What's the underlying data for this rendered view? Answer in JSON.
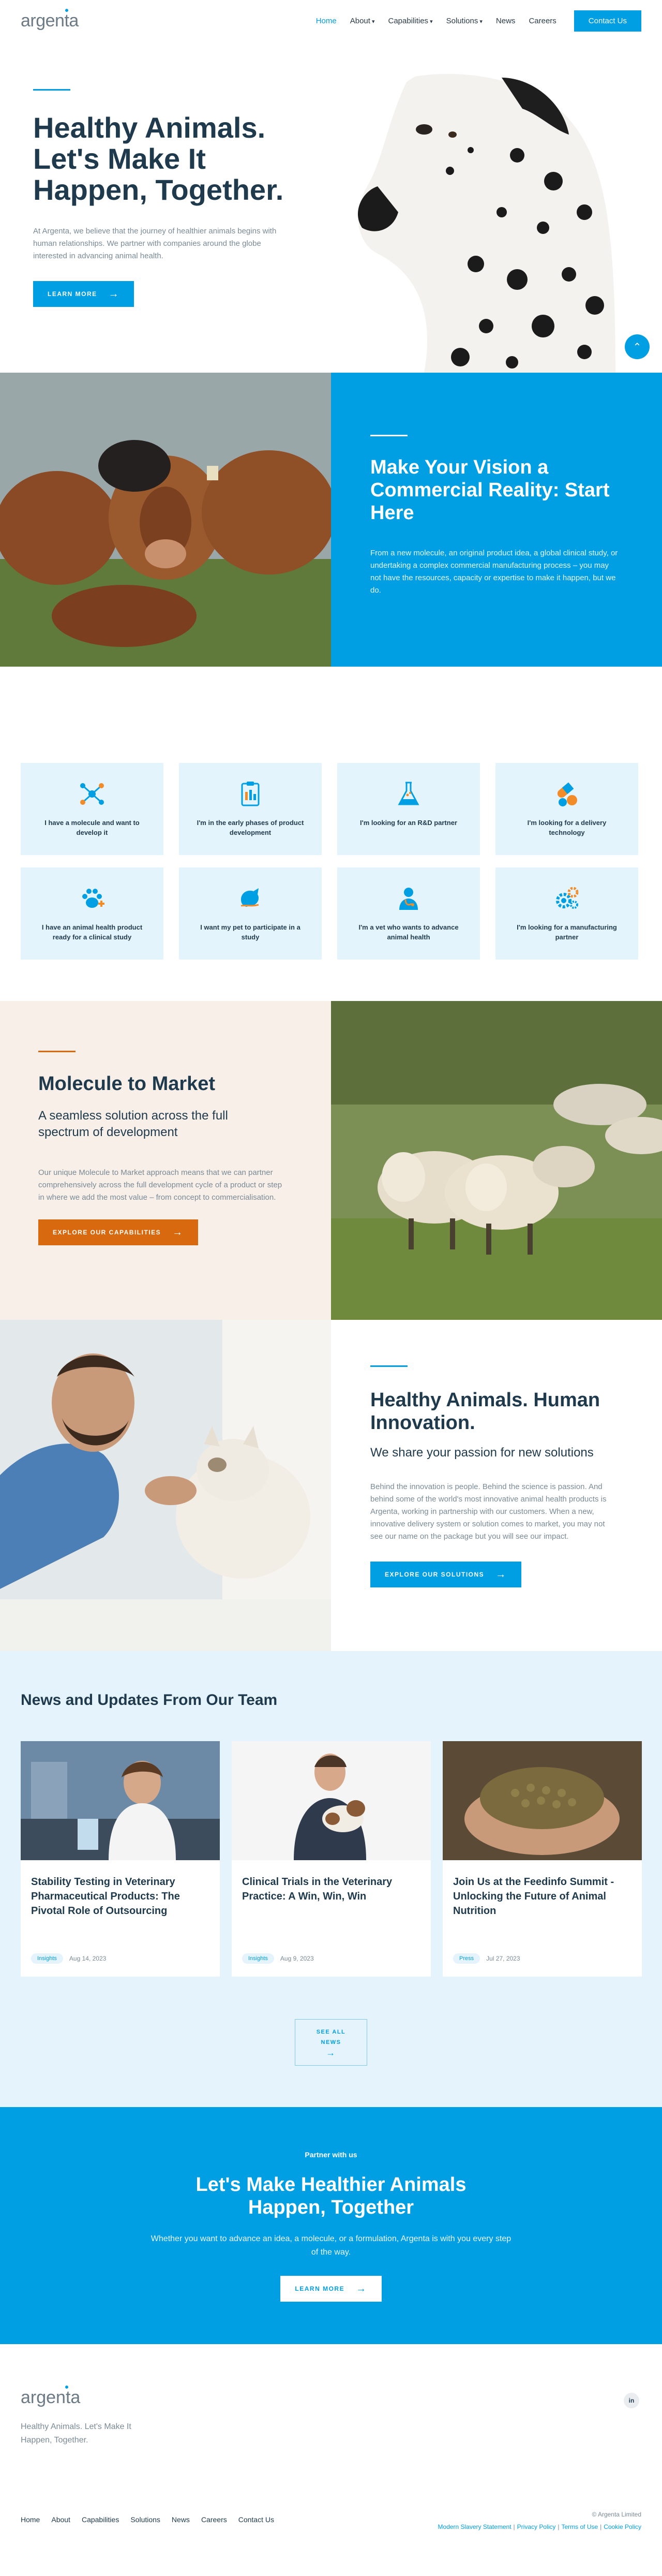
{
  "nav": {
    "logo": "argenta",
    "items": [
      {
        "label": "Home",
        "active": true,
        "dropdown": false
      },
      {
        "label": "About",
        "active": false,
        "dropdown": true
      },
      {
        "label": "Capabilities",
        "active": false,
        "dropdown": true
      },
      {
        "label": "Solutions",
        "active": false,
        "dropdown": true
      },
      {
        "label": "News",
        "active": false,
        "dropdown": false
      },
      {
        "label": "Careers",
        "active": false,
        "dropdown": false
      }
    ],
    "contact_label": "Contact Us"
  },
  "hero": {
    "title": "Healthy Animals. Let's Make It Happen, Together.",
    "body": "At Argenta, we believe that the journey of healthier animals begins with human relationships. We partner with companies around the globe interested in advancing animal health.",
    "cta": "Learn More"
  },
  "vision": {
    "title": "Make Your Vision a Commercial Reality: Start Here",
    "body": "From a new molecule, an original product idea, a global clinical study, or undertaking a complex commercial manufacturing process – you may not have the resources, capacity or expertise to make it happen, but we do."
  },
  "cards": [
    {
      "label": "I have a molecule and want to develop it",
      "icon": "molecule-icon"
    },
    {
      "label": "I'm in the early phases of product development",
      "icon": "clipboard-icon"
    },
    {
      "label": "I'm looking for an R&D partner",
      "icon": "flask-icon"
    },
    {
      "label": "I'm looking for a delivery technology",
      "icon": "capsule-icon"
    },
    {
      "label": "I have an animal health product ready for a clinical study",
      "icon": "paw-icon"
    },
    {
      "label": "I want my pet to participate in a study",
      "icon": "pet-icon"
    },
    {
      "label": "I'm a vet who wants to advance animal health",
      "icon": "vet-icon"
    },
    {
      "label": "I'm looking for a manufacturing partner",
      "icon": "gears-icon"
    }
  ],
  "molecule": {
    "title": "Molecule to Market",
    "subtitle": "A seamless solution across the full spectrum of development",
    "body": "Our unique Molecule to Market approach means that we can partner comprehensively across the full development cycle of a product or step in where we add the most value – from concept to commercialisation.",
    "cta": "Explore Our Capabilities"
  },
  "innovation": {
    "title": "Healthy Animals. Human Innovation.",
    "subtitle": "We share your passion for new solutions",
    "body": "Behind the innovation is people. Behind the science is passion. And behind some of the world's most innovative animal health products is Argenta, working in partnership with our customers. When a new, innovative delivery system or solution comes to market, you may not see our name on the package but you will see our impact.",
    "cta": "Explore Our Solutions"
  },
  "news": {
    "heading": "News and Updates From Our Team",
    "items": [
      {
        "title": "Stability Testing in Veterinary Pharmaceutical Products: The Pivotal Role of Outsourcing",
        "tag": "Insights",
        "date": "Aug 14, 2023"
      },
      {
        "title": "Clinical Trials in the Veterinary Practice: A Win, Win, Win",
        "tag": "Insights",
        "date": "Aug 9, 2023"
      },
      {
        "title": "Join Us at the Feedinfo Summit - Unlocking the Future of Animal Nutrition",
        "tag": "Press",
        "date": "Jul 27, 2023"
      }
    ],
    "see_all_1": "SEE ALL",
    "see_all_2": "NEWS"
  },
  "partner": {
    "eyebrow": "Partner with us",
    "title": "Let's Make Healthier Animals Happen, Together",
    "body": "Whether you want to advance an idea, a molecule, or a formulation, Argenta is with you every step of the way.",
    "cta": "Learn More"
  },
  "footer": {
    "logo": "argenta",
    "tagline": "Healthy Animals. Let's Make It Happen, Together.",
    "linkedin": "in",
    "links": [
      "Home",
      "About",
      "Capabilities",
      "Solutions",
      "News",
      "Careers",
      "Contact Us"
    ],
    "copyright": "© Argenta Limited",
    "legal": [
      "Modern Slavery Statement",
      "Privacy Policy",
      "Terms of Use",
      "Cookie Policy"
    ]
  },
  "colors": {
    "brand_blue": "#009fe3",
    "navy": "#1e3a4c",
    "orange": "#d9690e",
    "light_blue": "#e4f4fc",
    "cream": "#f7efe8"
  }
}
